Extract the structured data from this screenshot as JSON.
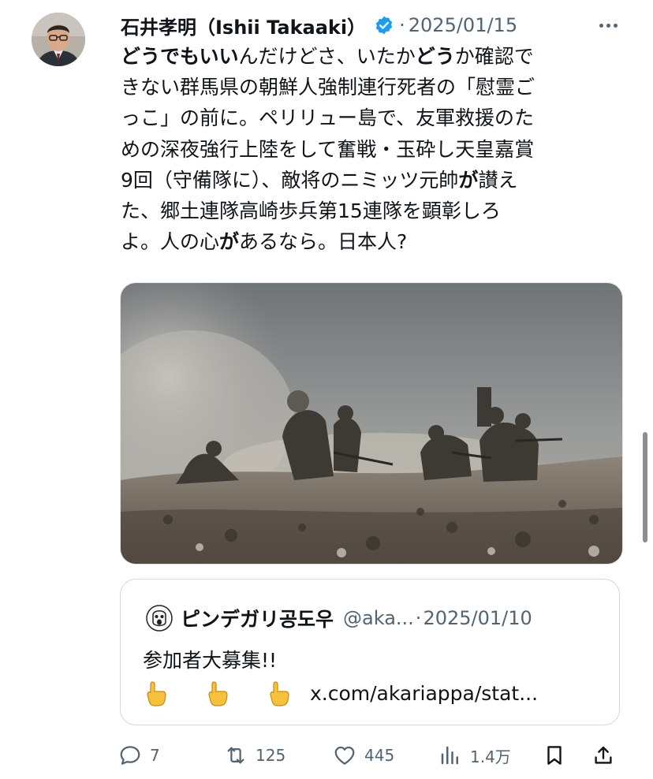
{
  "post": {
    "author_name": "石井孝明（Ishii Takaaki）",
    "date": "2025/01/15",
    "separator": "·",
    "text_lines": [
      [
        "どうでもいい",
        "んだけどさ、いたか",
        "どう",
        "か確認で"
      ],
      "きない群馬県の朝鮮人強制連行死者の「慰霊ご",
      "っこ」の前に。ペリリュー島で、友軍救援のた",
      "めの深夜強行上陸をして奮戦・玉砕し天皇嘉賞",
      [
        "9回（守備隊に）、敵将のニミッツ元帥",
        "が",
        "讃え"
      ],
      "た、郷土連隊高崎歩兵第15連隊を顕彰しろ",
      [
        "よ。人の心",
        "が",
        "あるなら。日本人?"
      ]
    ]
  },
  "quote": {
    "name": "ピンデガリ공도우",
    "handle": "@aka...",
    "separator": "·",
    "date": "2025/01/10",
    "line1": "参加者大募集!!",
    "link": "x.com/akariappa/stat..."
  },
  "actions": {
    "reply_count": "7",
    "repost_count": "125",
    "like_count": "445",
    "views_count": "1.4万"
  },
  "colors": {
    "text": "#0f1419",
    "secondary": "#536471",
    "verified": "#1d9bf0",
    "border": "#cfd9de"
  },
  "icons": [
    "verified-badge-icon",
    "more-icon",
    "reply-icon",
    "repost-icon",
    "like-icon",
    "views-icon",
    "bookmark-icon",
    "share-icon",
    "pointing-down-icon"
  ]
}
